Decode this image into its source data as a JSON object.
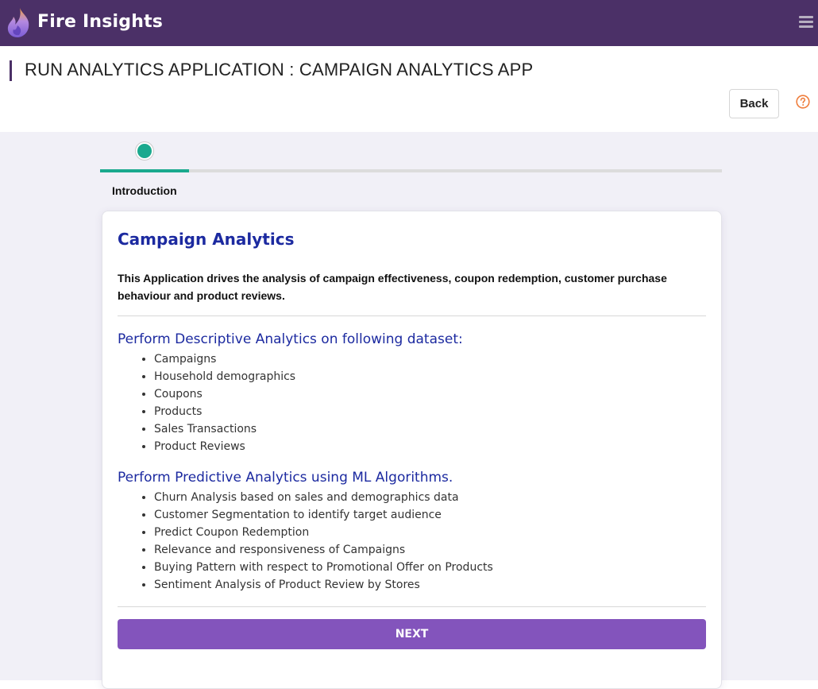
{
  "topbar": {
    "brand": "Fire Insights",
    "logo_icon": "flame-logo-icon",
    "menu_icon": "hamburger-menu-icon",
    "background_color": "#4b3067"
  },
  "header": {
    "title": "RUN ANALYTICS APPLICATION : CAMPAIGN ANALYTICS APP",
    "back_label": "Back",
    "help_icon": "question-circle-icon"
  },
  "stepper": {
    "steps": [
      {
        "label": "Introduction",
        "active": true
      }
    ],
    "progress_fraction": 0.143,
    "accent_color": "#1aa98e"
  },
  "card": {
    "title": "Campaign Analytics",
    "description": "This Application drives the analysis of campaign effectiveness, coupon redemption, customer purchase behaviour and product reviews.",
    "sections": [
      {
        "title": "Perform Descriptive Analytics on following dataset:",
        "items": [
          "Campaigns",
          "Household demographics",
          "Coupons",
          "Products",
          "Sales Transactions",
          "Product Reviews"
        ]
      },
      {
        "title": "Perform Predictive Analytics using ML Algorithms.",
        "items": [
          "Churn Analysis based on sales and demographics data",
          "Customer Segmentation to identify target audience",
          "Predict Coupon Redemption",
          "Relevance and responsiveness of Campaigns",
          "Buying Pattern with respect to Promotional Offer on Products",
          "Sentiment Analysis of Product Review by Stores"
        ]
      }
    ],
    "next_label": "NEXT",
    "next_color": "#8354bc",
    "heading_color": "#1c2aa0"
  }
}
